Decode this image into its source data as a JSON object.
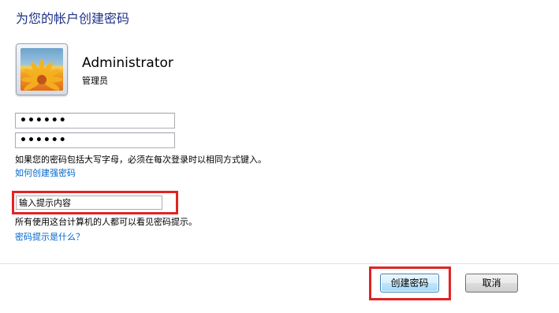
{
  "dialog": {
    "title": "为您的帐户创建密码"
  },
  "user": {
    "name": "Administrator",
    "role": "管理员"
  },
  "password": {
    "new_value": "••••••",
    "confirm_value": "••••••"
  },
  "notes": {
    "case_sensitive": "如果您的密码包括大写字母，必须在每次登录时以相同方式键入。",
    "strong_password_link": "如何创建强密码",
    "hint_visible": "所有使用这台计算机的人都可以看见密码提示。",
    "hint_help_link": "密码提示是什么？"
  },
  "hint": {
    "value": "输入提示内容"
  },
  "buttons": {
    "create_label": "创建密码",
    "cancel_label": "取消"
  },
  "colors": {
    "title": "#1e3287",
    "link": "#0066cc",
    "highlight": "#e02424"
  },
  "icons": {
    "avatar": "flower-avatar-icon"
  }
}
